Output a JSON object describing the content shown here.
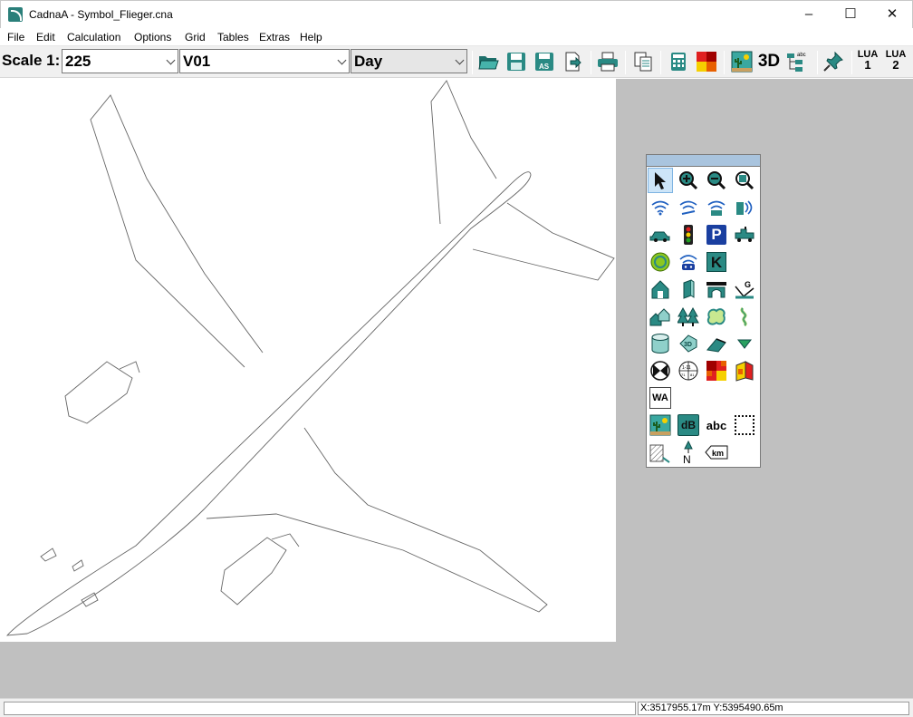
{
  "window": {
    "title": "CadnaA - Symbol_Flieger.cna"
  },
  "menu": [
    "File",
    "Edit",
    "Calculation",
    "Options",
    "Grid",
    "Tables",
    "Extras",
    "Help"
  ],
  "toolbar": {
    "scale_label": "Scale 1:",
    "scale_value": "225",
    "variant_value": "V01",
    "period_value": "Day",
    "lua1": [
      "LUA",
      "1"
    ],
    "lua2": [
      "LUA",
      "2"
    ],
    "btn_3d": "3D"
  },
  "palette": {
    "wa": "WA",
    "db": "dB",
    "abc": "abc",
    "km": "km",
    "north": "N",
    "parking": "P",
    "k": "K",
    "three_d": "3D"
  },
  "status": {
    "coords": "X:3517955.17m Y:5395490.65m"
  },
  "colors": {
    "accent_teal": "#2a8a84",
    "palette_header": "#a9c4de",
    "workarea": "#c0c0c0"
  }
}
